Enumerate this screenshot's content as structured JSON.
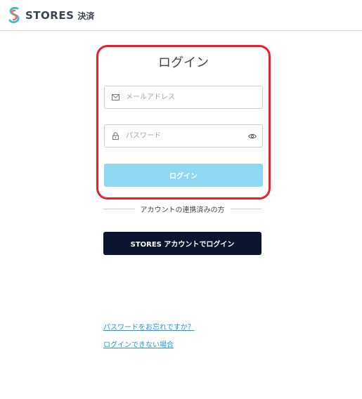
{
  "header": {
    "brand": "STORES",
    "brand_sub": "決済"
  },
  "login_form": {
    "title": "ログイン",
    "email_placeholder": "メールアドレス",
    "password_placeholder": "パスワード",
    "submit_label": "ログイン",
    "submit_color": "#8ed8f2",
    "highlight_color": "#e8202a"
  },
  "divider": {
    "label": "アカウントの連携済みの方"
  },
  "stores_login": {
    "label": "STORES アカウントでログイン",
    "color": "#0b1530"
  },
  "links": {
    "forgot_password": "パスワードをお忘れですか？",
    "cannot_login": "ログインできない場合"
  },
  "icons": [
    "stores-logo-icon",
    "mail-icon",
    "lock-icon",
    "eye-icon"
  ]
}
